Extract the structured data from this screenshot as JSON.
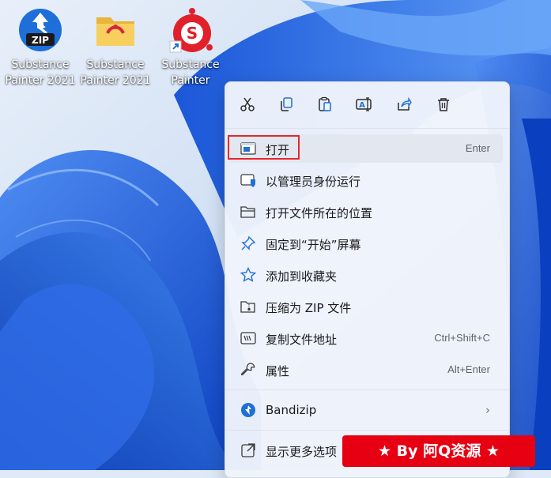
{
  "desktop": {
    "icons": [
      {
        "label_line1": "Substance",
        "label_line2": "Painter 2021",
        "icon": "zip-archive-icon"
      },
      {
        "label_line1": "Substance",
        "label_line2": "Painter 2021",
        "icon": "folder-icon"
      },
      {
        "label_line1": "Substance",
        "label_line2": "Painter",
        "icon": "substance-painter-shortcut-icon"
      }
    ]
  },
  "context_menu": {
    "toolbar": [
      {
        "icon": "cut-icon"
      },
      {
        "icon": "copy-icon"
      },
      {
        "icon": "paste-icon"
      },
      {
        "icon": "rename-icon"
      },
      {
        "icon": "share-icon"
      },
      {
        "icon": "delete-icon"
      }
    ],
    "items": [
      {
        "label": "打开",
        "shortcut": "Enter",
        "icon": "open-icon"
      },
      {
        "label": "以管理员身份运行",
        "shortcut": "",
        "icon": "run-as-admin-icon"
      },
      {
        "label": "打开文件所在的位置",
        "shortcut": "",
        "icon": "folder-open-icon"
      },
      {
        "label": "固定到“开始”屏幕",
        "shortcut": "",
        "icon": "pin-icon"
      },
      {
        "label": "添加到收藏夹",
        "shortcut": "",
        "icon": "star-icon"
      },
      {
        "label": "压缩为 ZIP 文件",
        "shortcut": "",
        "icon": "zip-folder-icon"
      },
      {
        "label": "复制文件地址",
        "shortcut": "Ctrl+Shift+C",
        "icon": "copy-path-icon"
      },
      {
        "label": "属性",
        "shortcut": "Alt+Enter",
        "icon": "wrench-icon"
      },
      {
        "label": "Bandizip",
        "shortcut": "",
        "icon": "bandizip-icon"
      },
      {
        "label": "显示更多选项",
        "shortcut": "",
        "icon": "show-more-icon"
      }
    ]
  },
  "watermark": {
    "text": "★ By 阿Q资源 ★"
  },
  "colors": {
    "highlight_border": "#e8262a",
    "watermark_bg": "#e60012",
    "accent_blue": "#1f6fd6"
  }
}
